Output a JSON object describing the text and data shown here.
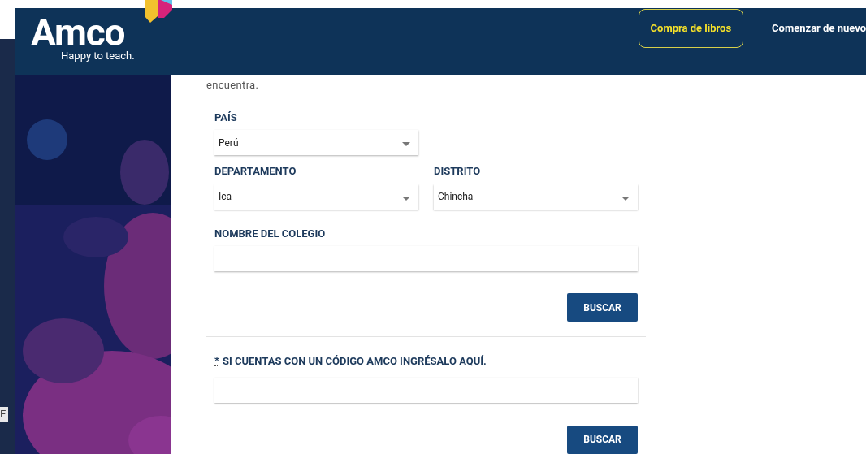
{
  "header": {
    "logo": {
      "name": "Amco",
      "tagline": "Happy to teach."
    },
    "buttons": [
      {
        "label": "Compra de libros",
        "kind": "outlined"
      },
      {
        "label": "Comenzar de nuevo",
        "kind": "plain"
      }
    ]
  },
  "side_tab": "E",
  "intro_text": "encuentra.",
  "search_form": {
    "rows": [
      [
        {
          "label": "PAÍS",
          "kind": "select",
          "value": "Perú"
        }
      ],
      [
        {
          "label": "DEPARTAMENTO",
          "kind": "select",
          "value": "Ica"
        },
        {
          "label": "DISTRITO",
          "kind": "select",
          "value": "Chincha"
        }
      ],
      [
        {
          "label": "NOMBRE DEL COLEGIO",
          "kind": "text"
        }
      ]
    ],
    "button": "BUSCAR"
  },
  "code_form": {
    "required_mark": "*",
    "label": "SI CUENTAS CON UN CÓDIGO AMCO INGRÉSALO AQUÍ.",
    "button": "BUSCAR"
  }
}
